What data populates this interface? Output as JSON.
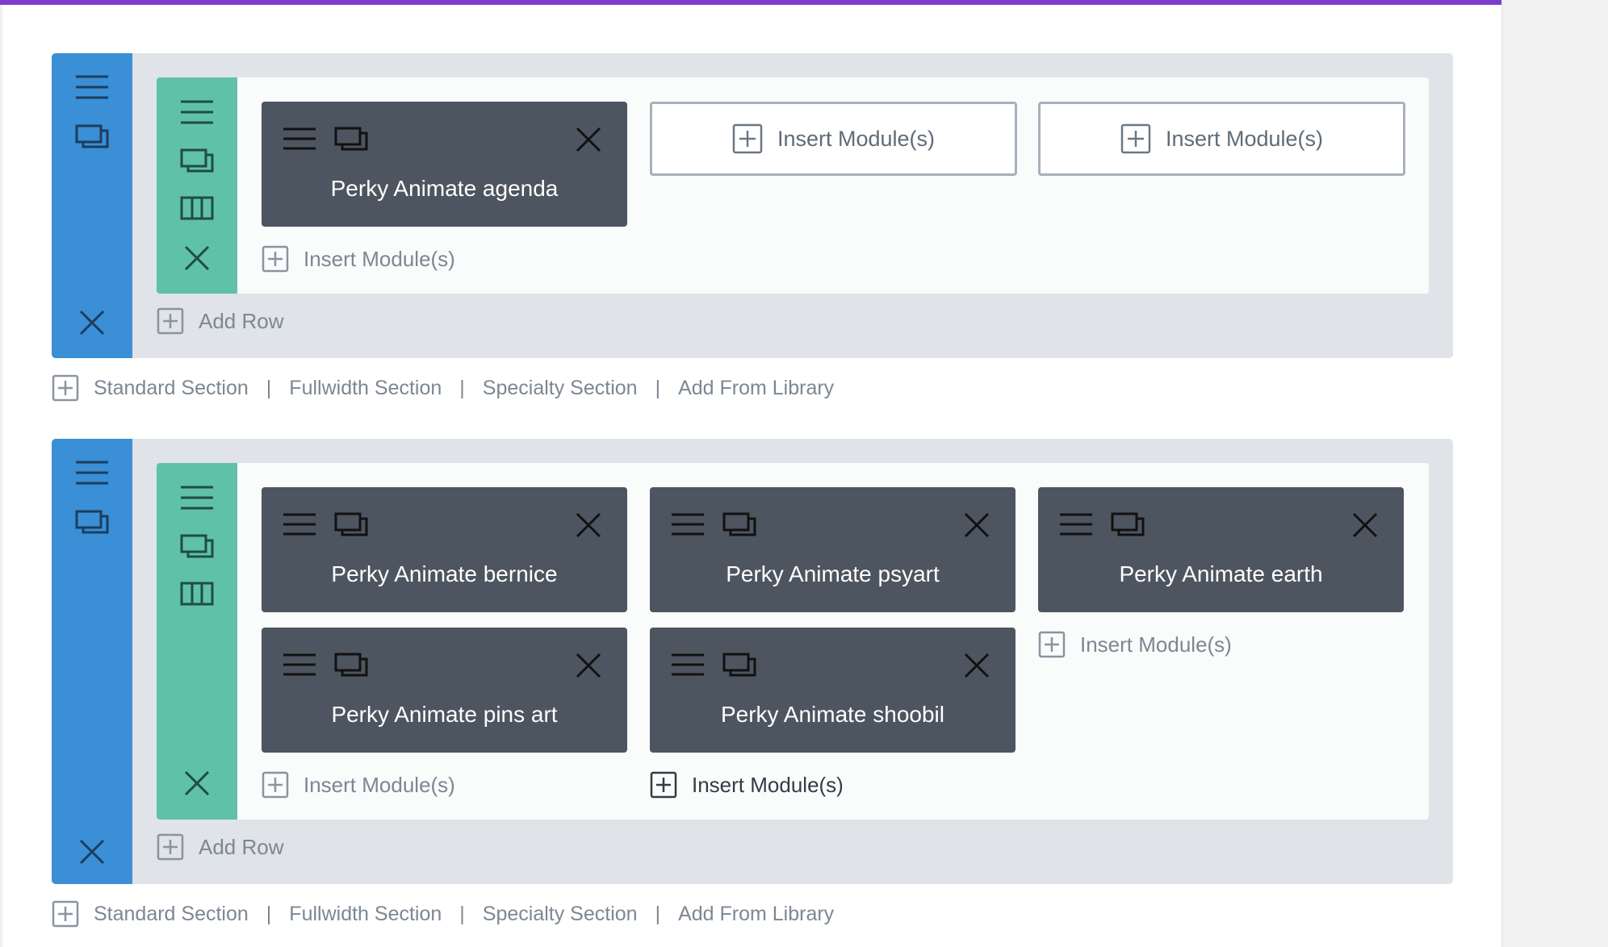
{
  "colors": {
    "accent_purple": "#7e3bd0",
    "section_blue": "#3a8fd6",
    "row_green": "#5fc1a8",
    "module_dark": "#4d5560",
    "section_bg": "#e0e3e7",
    "row_bg": "#fafbfb"
  },
  "icons": [
    "hamburger-icon",
    "duplicate-icon",
    "columns-icon",
    "close-icon",
    "plus-square-icon"
  ],
  "insert_module_label": "Insert Module(s)",
  "add_row_label": "Add Row",
  "section_actions": {
    "standard": "Standard Section",
    "fullwidth": "Fullwidth Section",
    "specialty": "Specialty Section",
    "library": "Add From Library",
    "separator": "|"
  },
  "sections": [
    {
      "modules": [
        {
          "title": "Perky Animate agenda"
        }
      ]
    },
    {
      "modules": [
        {
          "title": "Perky Animate bernice"
        },
        {
          "title": "Perky Animate psyart"
        },
        {
          "title": "Perky Animate earth"
        },
        {
          "title": "Perky Animate pins art"
        },
        {
          "title": "Perky Animate shoobil"
        }
      ]
    }
  ]
}
